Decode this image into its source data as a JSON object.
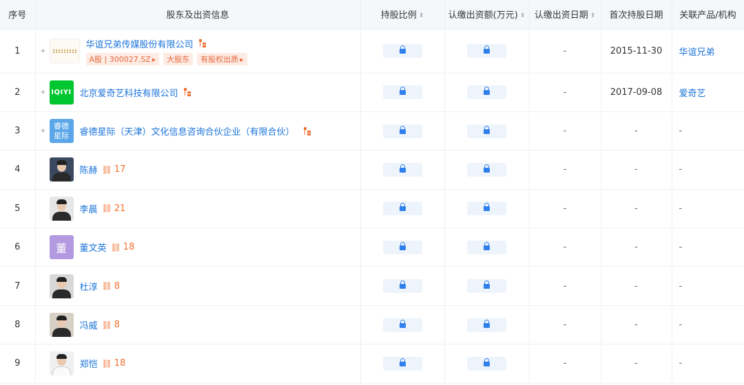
{
  "header": {
    "idx": "序号",
    "name": "股东及出资信息",
    "ratio": "持股比例",
    "amount": "认缴出资额(万元)",
    "date": "认缴出资日期",
    "first": "首次持股日期",
    "related": "关联产品/机构"
  },
  "rows": [
    {
      "idx": "1",
      "name": "华谊兄弟传媒股份有限公司",
      "tags": [
        "A股 | 300027.SZ",
        "大股东",
        "有股权出质"
      ],
      "date": "-",
      "first": "2015-11-30",
      "related": "华谊兄弟"
    },
    {
      "idx": "2",
      "logo_text": "IQIYI",
      "name": "北京爱奇艺科技有限公司",
      "date": "-",
      "first": "2017-09-08",
      "related": "爱奇艺"
    },
    {
      "idx": "3",
      "logo_text1": "睿德",
      "logo_text2": "星际",
      "name": "睿德星际（天津）文化信息咨询合伙企业（有限合伙）",
      "date": "-",
      "first": "-",
      "related": "-"
    },
    {
      "idx": "4",
      "name": "陈赫",
      "count": "17",
      "date": "-",
      "first": "-",
      "related": "-"
    },
    {
      "idx": "5",
      "name": "李晨",
      "count": "21",
      "date": "-",
      "first": "-",
      "related": "-"
    },
    {
      "idx": "6",
      "logo_text": "董",
      "name": "董文英",
      "count": "18",
      "date": "-",
      "first": "-",
      "related": "-"
    },
    {
      "idx": "7",
      "name": "杜淳",
      "count": "8",
      "date": "-",
      "first": "-",
      "related": "-"
    },
    {
      "idx": "8",
      "name": "冯威",
      "count": "8",
      "date": "-",
      "first": "-",
      "related": "-"
    },
    {
      "idx": "9",
      "name": "郑恺",
      "count": "18",
      "date": "-",
      "first": "-",
      "related": "-"
    }
  ],
  "icons": {
    "lock": "lock-icon",
    "tree": "equity-tree-icon",
    "relation": "relation-icon",
    "sort": "sort-icon"
  },
  "colors": {
    "link": "#1a73d9",
    "accent": "#f0702f",
    "header_bg": "#f5f8fb"
  }
}
